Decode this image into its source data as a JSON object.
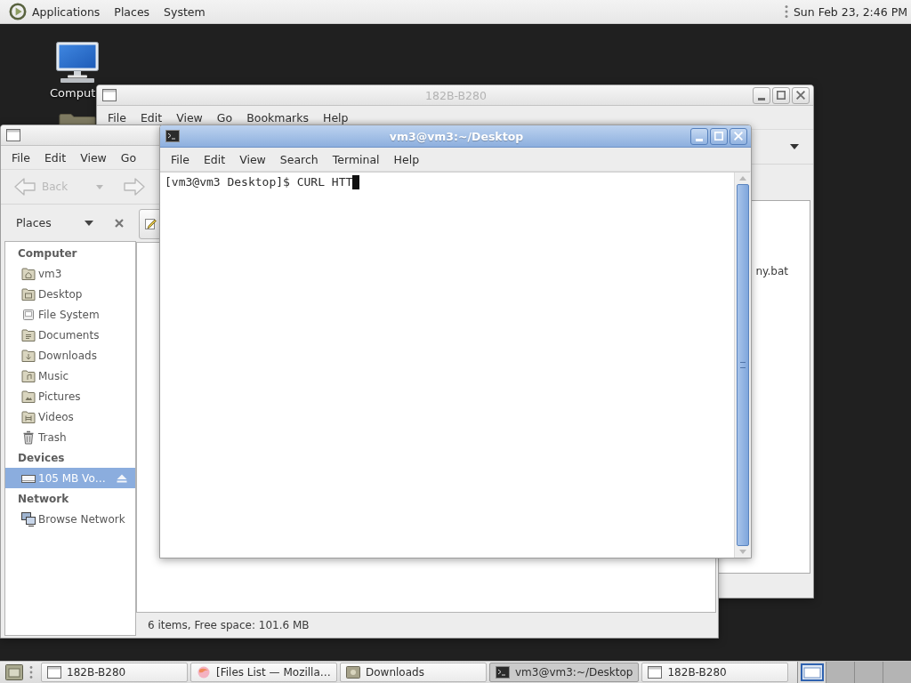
{
  "top_panel": {
    "menus": [
      "Applications",
      "Places",
      "System"
    ],
    "clock": "Sun Feb 23, 2:46 PM"
  },
  "desktop_icons": [
    {
      "kind": "computer",
      "label": "Comput"
    },
    {
      "kind": "folder"
    }
  ],
  "back_window": {
    "title": "182B-B280",
    "active": false,
    "menu": [
      "File",
      "Edit",
      "View",
      "Go",
      "Bookmarks",
      "Help"
    ],
    "file_label": "ny.bat"
  },
  "file_manager": {
    "active": false,
    "menu": [
      "File",
      "Edit",
      "View",
      "Go"
    ],
    "toolbar": {
      "back": {
        "label": "Back",
        "disabled": true
      },
      "forward": {
        "disabled": true
      }
    },
    "sidebar": {
      "title": "Places",
      "sections": [
        {
          "heading": "Computer",
          "items": [
            {
              "label": "vm3",
              "kind": "home",
              "selected": false,
              "eject": false
            },
            {
              "label": "Desktop",
              "kind": "desktop",
              "selected": false,
              "eject": false
            },
            {
              "label": "File System",
              "kind": "filesystem",
              "selected": false,
              "eject": false
            },
            {
              "label": "Documents",
              "kind": "documents",
              "selected": false,
              "eject": false
            },
            {
              "label": "Downloads",
              "kind": "downloads",
              "selected": false,
              "eject": false
            },
            {
              "label": "Music",
              "kind": "music",
              "selected": false,
              "eject": false
            },
            {
              "label": "Pictures",
              "kind": "pictures",
              "selected": false,
              "eject": false
            },
            {
              "label": "Videos",
              "kind": "videos",
              "selected": false,
              "eject": false
            },
            {
              "label": "Trash",
              "kind": "trash",
              "selected": false,
              "eject": false
            }
          ]
        },
        {
          "heading": "Devices",
          "items": [
            {
              "label": "105 MB Vo…",
              "kind": "drive",
              "selected": true,
              "eject": true
            }
          ]
        },
        {
          "heading": "Network",
          "items": [
            {
              "label": "Browse Network",
              "kind": "network",
              "selected": false,
              "eject": false
            }
          ]
        }
      ]
    },
    "status": "6 items, Free space: 101.6 MB"
  },
  "terminal": {
    "title": "vm3@vm3:~/Desktop",
    "active": true,
    "menu": [
      "File",
      "Edit",
      "View",
      "Search",
      "Terminal",
      "Help"
    ],
    "lines": [
      "[vm3@vm3 Desktop]$ CURL HTT"
    ]
  },
  "taskbar": {
    "tasks": [
      {
        "label": "182B-B280",
        "kind": "window",
        "selected": false
      },
      {
        "label": "[Files List — Mozilla…",
        "kind": "browser",
        "selected": false
      },
      {
        "label": "Downloads",
        "kind": "folder",
        "selected": false
      },
      {
        "label": "vm3@vm3:~/Desktop",
        "kind": "terminal",
        "selected": true
      },
      {
        "label": "182B-B280",
        "kind": "window",
        "selected": false
      }
    ],
    "workspaces": [
      {
        "selected": true
      },
      {
        "selected": false
      },
      {
        "selected": false
      },
      {
        "selected": false
      }
    ]
  }
}
